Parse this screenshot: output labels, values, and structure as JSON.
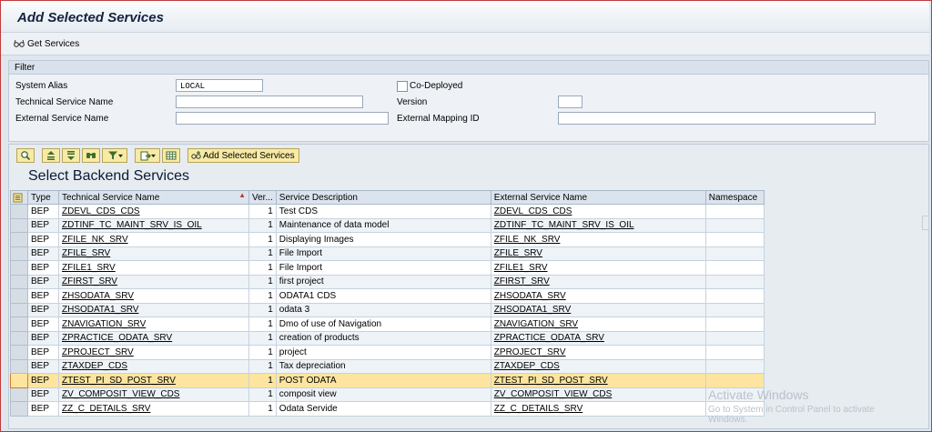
{
  "window": {
    "title": "Add Selected Services"
  },
  "toolbar": {
    "get_services": "Get Services"
  },
  "filter": {
    "header": "Filter",
    "system_alias_label": "System Alias",
    "system_alias_value": "LOCAL",
    "co_deployed_label": "Co-Deployed",
    "technical_service_name_label": "Technical Service Name",
    "technical_service_name_value": "",
    "version_label": "Version",
    "version_value": "",
    "external_service_name_label": "External Service Name",
    "external_service_name_value": "",
    "external_mapping_id_label": "External Mapping ID",
    "external_mapping_id_value": ""
  },
  "grid_toolbar": {
    "icons": [
      "details-icon",
      "sort-ascending-icon",
      "sort-descending-icon",
      "find-icon",
      "filter-icon",
      "export-icon",
      "layout-icon"
    ],
    "add_selected_services": "Add Selected Services"
  },
  "grid": {
    "title": "Select Backend Services",
    "columns": [
      "Type",
      "Technical Service Name",
      "Ver...",
      "Service Description",
      "External Service Name",
      "Namespace"
    ],
    "rows": [
      {
        "type": "BEP",
        "tech_name": "ZDEVL_CDS_CDS",
        "version": "1",
        "description": "Test CDS",
        "ext_name": "ZDEVL_CDS_CDS",
        "namespace": ""
      },
      {
        "type": "BEP",
        "tech_name": "ZDTINF_TC_MAINT_SRV_IS_OIL",
        "version": "1",
        "description": "Maintenance of data model",
        "ext_name": "ZDTINF_TC_MAINT_SRV_IS_OIL",
        "namespace": ""
      },
      {
        "type": "BEP",
        "tech_name": "ZFILE_NK_SRV",
        "version": "1",
        "description": "Displaying Images",
        "ext_name": "ZFILE_NK_SRV",
        "namespace": ""
      },
      {
        "type": "BEP",
        "tech_name": "ZFILE_SRV",
        "version": "1",
        "description": "File Import",
        "ext_name": "ZFILE_SRV",
        "namespace": ""
      },
      {
        "type": "BEP",
        "tech_name": "ZFILE1_SRV",
        "version": "1",
        "description": "File Import",
        "ext_name": "ZFILE1_SRV",
        "namespace": ""
      },
      {
        "type": "BEP",
        "tech_name": "ZFIRST_SRV",
        "version": "1",
        "description": "first project",
        "ext_name": "ZFIRST_SRV",
        "namespace": ""
      },
      {
        "type": "BEP",
        "tech_name": "ZHSODATA_SRV",
        "version": "1",
        "description": "ODATA1 CDS",
        "ext_name": "ZHSODATA_SRV",
        "namespace": ""
      },
      {
        "type": "BEP",
        "tech_name": "ZHSODATA1_SRV",
        "version": "1",
        "description": "odata 3",
        "ext_name": "ZHSODATA1_SRV",
        "namespace": ""
      },
      {
        "type": "BEP",
        "tech_name": "ZNAVIGATION_SRV",
        "version": "1",
        "description": "Dmo of use of Navigation",
        "ext_name": "ZNAVIGATION_SRV",
        "namespace": ""
      },
      {
        "type": "BEP",
        "tech_name": "ZPRACTICE_ODATA_SRV",
        "version": "1",
        "description": "creation of products",
        "ext_name": "ZPRACTICE_ODATA_SRV",
        "namespace": ""
      },
      {
        "type": "BEP",
        "tech_name": "ZPROJECT_SRV",
        "version": "1",
        "description": "project",
        "ext_name": "ZPROJECT_SRV",
        "namespace": ""
      },
      {
        "type": "BEP",
        "tech_name": "ZTAXDEP_CDS",
        "version": "1",
        "description": "Tax depreciation",
        "ext_name": "ZTAXDEP_CDS",
        "namespace": ""
      },
      {
        "type": "BEP",
        "tech_name": "ZTEST_PI_SD_POST_SRV",
        "version": "1",
        "description": "POST ODATA",
        "ext_name": "ZTEST_PI_SD_POST_SRV",
        "namespace": "",
        "highlighted": true
      },
      {
        "type": "BEP",
        "tech_name": "ZV_COMPOSIT_VIEW_CDS",
        "version": "1",
        "description": "composit view",
        "ext_name": "ZV_COMPOSIT_VIEW_CDS",
        "namespace": ""
      },
      {
        "type": "BEP",
        "tech_name": "ZZ_C_DETAILS_SRV",
        "version": "1",
        "description": "Odata Servide",
        "ext_name": "ZZ_C_DETAILS_SRV",
        "namespace": ""
      }
    ]
  },
  "watermark": {
    "line1": "Activate Windows",
    "line2": "Go to System in Control Panel to activate",
    "line3": "Windows."
  },
  "colors": {
    "highlight_row": "#fde5a0",
    "toolbar_button": "#f7eaa5",
    "title_text": "#12233e"
  }
}
